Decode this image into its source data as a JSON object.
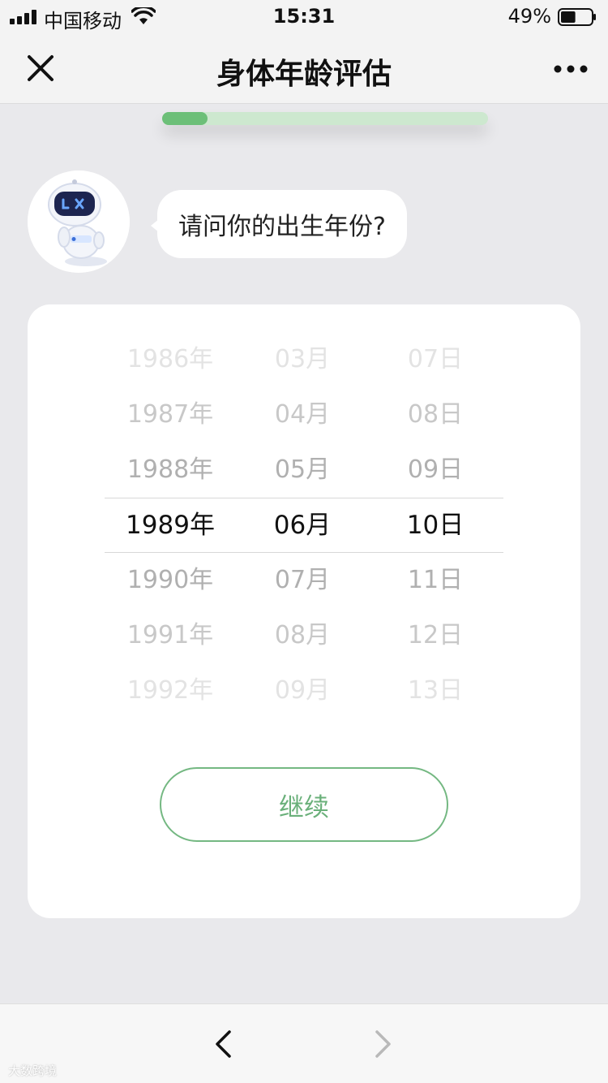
{
  "status_bar": {
    "carrier": "中国移动",
    "time": "15:31",
    "battery_percent": "49%",
    "battery_level": 0.49,
    "icons": [
      "signal-icon",
      "wifi-icon",
      "battery-icon"
    ]
  },
  "nav": {
    "title": "身体年龄评估",
    "close_icon": "close-icon",
    "more_icon": "more-icon"
  },
  "progress": {
    "fraction": 0.14,
    "fill_color": "#6cbf78",
    "track_color": "#cde8cf"
  },
  "chat": {
    "avatar_icon": "robot-avatar-icon",
    "question": "请问你的出生年份?"
  },
  "picker": {
    "years": [
      "1986年",
      "1987年",
      "1988年",
      "1989年",
      "1990年",
      "1991年",
      "1992年"
    ],
    "months": [
      "03月",
      "04月",
      "05月",
      "06月",
      "07月",
      "08月",
      "09月"
    ],
    "days": [
      "07日",
      "08日",
      "09日",
      "10日",
      "11日",
      "12日",
      "13日"
    ],
    "selected": {
      "year": "1989年",
      "month": "06月",
      "day": "10日"
    }
  },
  "continue_label": "继续",
  "toolbar": {
    "back_icon": "chevron-left-icon",
    "forward_icon": "chevron-right-icon"
  },
  "watermark": "大数跨境",
  "colors": {
    "accent": "#6ab07a",
    "background": "#e9e9ec"
  }
}
